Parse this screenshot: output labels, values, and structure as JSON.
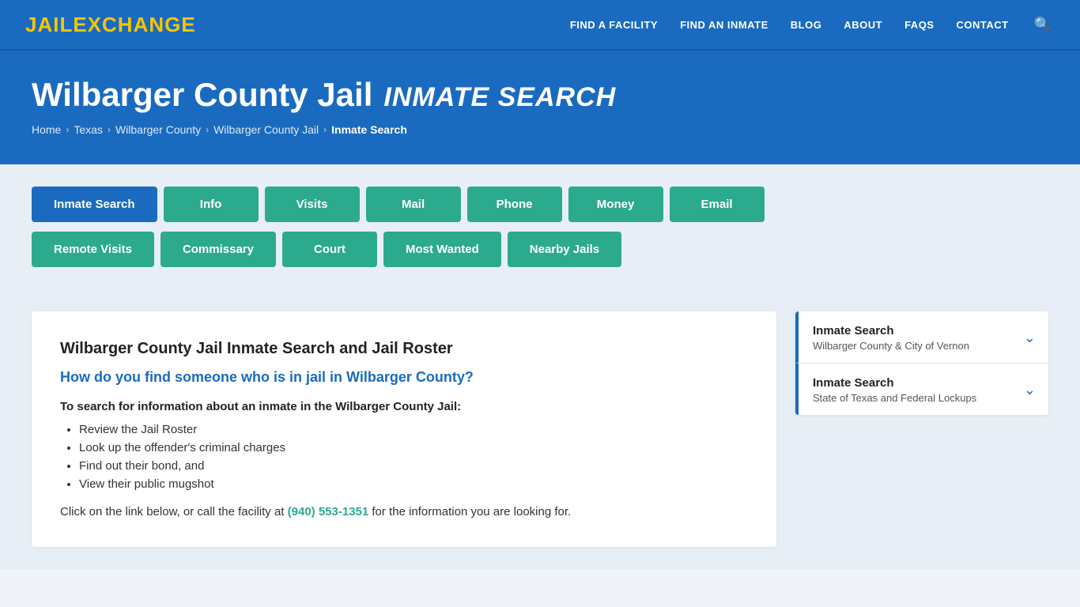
{
  "header": {
    "logo_jail": "JAIL",
    "logo_exchange": "EXCHANGE",
    "nav_items": [
      {
        "label": "FIND A FACILITY",
        "href": "#"
      },
      {
        "label": "FIND AN INMATE",
        "href": "#"
      },
      {
        "label": "BLOG",
        "href": "#"
      },
      {
        "label": "ABOUT",
        "href": "#"
      },
      {
        "label": "FAQs",
        "href": "#"
      },
      {
        "label": "CONTACT",
        "href": "#"
      }
    ]
  },
  "hero": {
    "title_main": "Wilbarger County Jail",
    "title_italic": "INMATE SEARCH",
    "breadcrumb": [
      {
        "label": "Home",
        "href": "#"
      },
      {
        "label": "Texas",
        "href": "#"
      },
      {
        "label": "Wilbarger County",
        "href": "#"
      },
      {
        "label": "Wilbarger County Jail",
        "href": "#"
      },
      {
        "label": "Inmate Search",
        "current": true
      }
    ]
  },
  "tabs": {
    "row1": [
      {
        "label": "Inmate Search",
        "active": true
      },
      {
        "label": "Info",
        "active": false
      },
      {
        "label": "Visits",
        "active": false
      },
      {
        "label": "Mail",
        "active": false
      },
      {
        "label": "Phone",
        "active": false
      },
      {
        "label": "Money",
        "active": false
      },
      {
        "label": "Email",
        "active": false
      }
    ],
    "row2": [
      {
        "label": "Remote Visits",
        "active": false
      },
      {
        "label": "Commissary",
        "active": false
      },
      {
        "label": "Court",
        "active": false
      },
      {
        "label": "Most Wanted",
        "active": false
      },
      {
        "label": "Nearby Jails",
        "active": false
      }
    ]
  },
  "content": {
    "heading": "Wilbarger County Jail Inmate Search and Jail Roster",
    "blue_question": "How do you find someone who is in jail in Wilbarger County?",
    "bold_para": "To search for information about an inmate in the Wilbarger County Jail:",
    "bullet_items": [
      "Review the Jail Roster",
      "Look up the offender's criminal charges",
      "Find out their bond, and",
      "View their public mugshot"
    ],
    "bottom_para_prefix": "Click on the link below, or call the facility at ",
    "phone": "(940) 553-1351",
    "bottom_para_suffix": " for the information you are looking for."
  },
  "sidebar": {
    "items": [
      {
        "title": "Inmate Search",
        "subtitle": "Wilbarger County & City of Vernon"
      },
      {
        "title": "Inmate Search",
        "subtitle": "State of Texas and Federal Lockups"
      }
    ]
  }
}
